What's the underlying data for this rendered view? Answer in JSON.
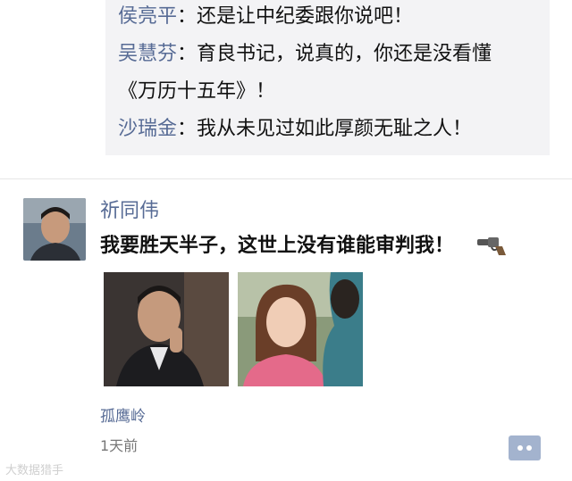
{
  "comments": [
    {
      "name": "侯亮平",
      "text": "：还是让中纪委跟你说吧！"
    },
    {
      "name": "吴慧芬",
      "text": "：育良书记，说真的，你还是没看懂"
    },
    {
      "name": "",
      "text": "《万历十五年》！"
    },
    {
      "name": "沙瑞金",
      "text": "：我从未见过如此厚颜无耻之人！"
    }
  ],
  "post": {
    "author": "祈同伟",
    "text": "我要胜天半子，这世上没有谁能审判我！",
    "emoji_icon": "revolver-icon",
    "location": "孤鹰岭",
    "time": "1天前"
  },
  "watermark": "大数据猎手",
  "colors": {
    "name_link": "#576b95",
    "comment_bg": "#f3f3f5",
    "action_button": "#a3b3ce"
  }
}
